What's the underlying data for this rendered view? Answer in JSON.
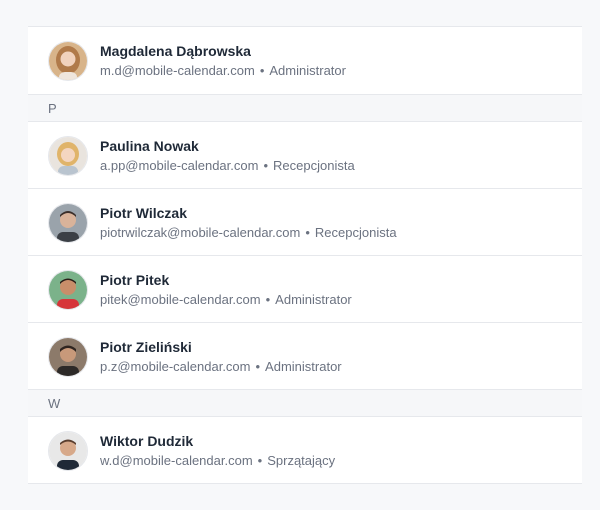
{
  "users": [
    {
      "name": "Magdalena Dąbrowska",
      "email": "m.d@mobile-calendar.com",
      "role": "Administrator"
    },
    {
      "name": "Paulina Nowak",
      "email": "a.pp@mobile-calendar.com",
      "role": "Recepcjonista"
    },
    {
      "name": "Piotr Wilczak",
      "email": "piotrwilczak@mobile-calendar.com",
      "role": "Recepcjonista"
    },
    {
      "name": "Piotr Pitek",
      "email": "pitek@mobile-calendar.com",
      "role": "Administrator"
    },
    {
      "name": "Piotr Zieliński",
      "email": "p.z@mobile-calendar.com",
      "role": "Administrator"
    },
    {
      "name": "Wiktor Dudzik",
      "email": "w.d@mobile-calendar.com",
      "role": "Sprzątający"
    }
  ],
  "sections": {
    "p": "P",
    "w": "W"
  },
  "separator": "•",
  "colors": {
    "background": "#f7f8fa",
    "section_bg": "#f6f7f9",
    "border": "#e6e8ec",
    "name": "#1f2937",
    "meta": "#6b7280"
  }
}
